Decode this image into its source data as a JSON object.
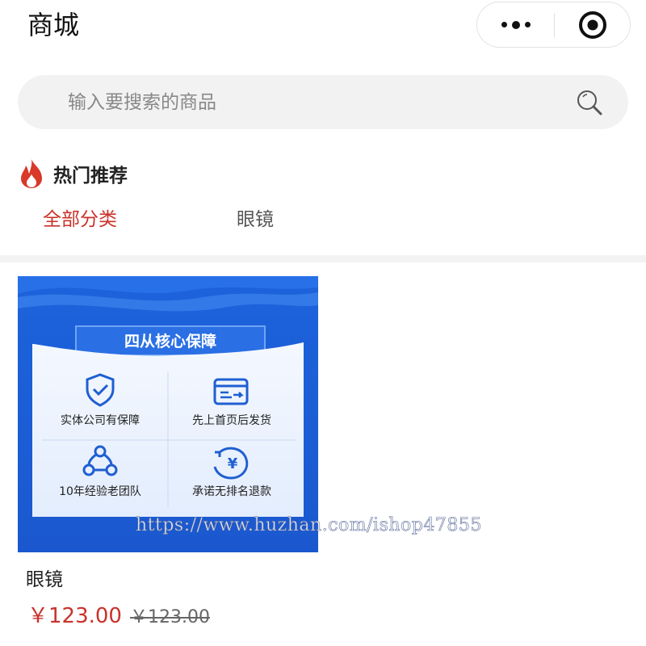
{
  "header": {
    "title": "商城"
  },
  "search": {
    "placeholder": "输入要搜索的商品",
    "value": ""
  },
  "section": {
    "title": "热门推荐"
  },
  "tabs": [
    {
      "label": "全部分类",
      "active": true
    },
    {
      "label": "眼镜",
      "active": false
    }
  ],
  "products": [
    {
      "name": "眼镜",
      "price": "￥123.00",
      "original_price": "￥123.00",
      "image": {
        "banner_title": "四从核心保障",
        "features": [
          "实体公司有保障",
          "先上首页后发货",
          "10年经验老团队",
          "承诺无排名退款"
        ]
      }
    }
  ],
  "watermark": "https://www.huzhan.com/ishop47855",
  "colors": {
    "accent": "#c9322a",
    "banner_blue": "#1a5fd6",
    "search_bg": "#f2f2f2"
  },
  "icons": {
    "more": "more-dots-icon",
    "close": "target-close-icon",
    "search": "search-icon",
    "hot": "flame-icon"
  }
}
